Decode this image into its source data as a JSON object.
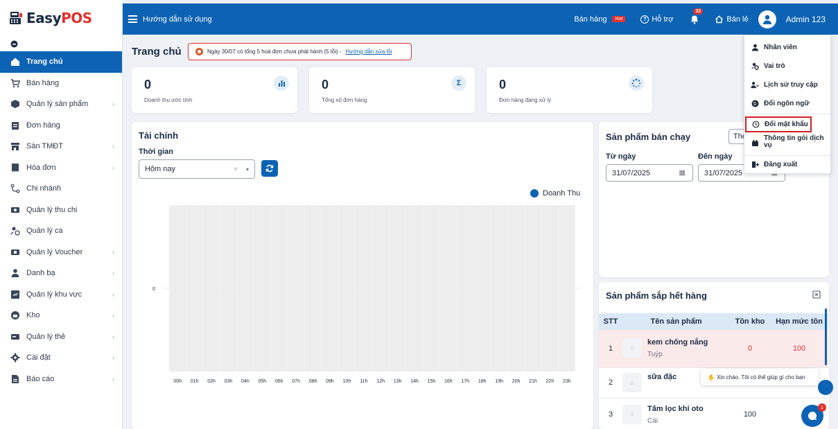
{
  "brand": {
    "name_a": "Easy",
    "name_b": "POS"
  },
  "sidebar": {
    "items": [
      {
        "label": "Trang chủ",
        "icon": "home-icon",
        "active": true,
        "chevron": false
      },
      {
        "label": "Bán hàng",
        "icon": "cart-icon",
        "active": false,
        "chevron": false
      },
      {
        "label": "Quản lý sản phẩm",
        "icon": "box-icon",
        "active": false,
        "chevron": true
      },
      {
        "label": "Đơn hàng",
        "icon": "clipboard-icon",
        "active": false,
        "chevron": false
      },
      {
        "label": "Sàn TMĐT",
        "icon": "store-icon",
        "active": false,
        "chevron": true
      },
      {
        "label": "Hóa đơn",
        "icon": "invoice-icon",
        "active": false,
        "chevron": true
      },
      {
        "label": "Chi nhánh",
        "icon": "branch-icon",
        "active": false,
        "chevron": false
      },
      {
        "label": "Quản lý thu chi",
        "icon": "money-icon",
        "active": false,
        "chevron": false
      },
      {
        "label": "Quản lý ca",
        "icon": "shift-icon",
        "active": false,
        "chevron": false
      },
      {
        "label": "Quản lý Voucher",
        "icon": "voucher-icon",
        "active": false,
        "chevron": true
      },
      {
        "label": "Danh bạ",
        "icon": "contact-icon",
        "active": false,
        "chevron": true
      },
      {
        "label": "Quản lý khu vực",
        "icon": "map-icon",
        "active": false,
        "chevron": true
      },
      {
        "label": "Kho",
        "icon": "warehouse-icon",
        "active": false,
        "chevron": true
      },
      {
        "label": "Quản lý thẻ",
        "icon": "card-icon",
        "active": false,
        "chevron": true
      },
      {
        "label": "Cài đặt",
        "icon": "gear-icon",
        "active": false,
        "chevron": true
      },
      {
        "label": "Báo cáo",
        "icon": "report-icon",
        "active": false,
        "chevron": true
      }
    ]
  },
  "topbar": {
    "title": "Hướng dẫn sử dụng",
    "sale": "Bán hàng",
    "hot": "Hot",
    "support": "Hỗ trợ",
    "notif_count": "32",
    "retail": "Bán lẻ",
    "user": "Admin 123"
  },
  "dropdown": {
    "items": [
      {
        "label": "Nhân viên",
        "icon": "user-icon"
      },
      {
        "label": "Vai trò",
        "icon": "role-icon"
      },
      {
        "label": "Lịch sử truy cập",
        "icon": "history-icon"
      },
      {
        "label": "Đổi ngôn ngữ",
        "icon": "globe-icon"
      },
      {
        "label": "Đổi mật khẩu",
        "icon": "key-icon"
      },
      {
        "label": "Thông tin gói dịch vụ",
        "icon": "package-icon"
      },
      {
        "label": "Đăng xuất",
        "icon": "logout-icon"
      }
    ]
  },
  "page": {
    "title": "Trang chủ",
    "alert_text": "Ngày 30/07 có tổng 5 hoá đơn chưa phát hành (5 lỗi) -",
    "alert_link": "Hướng dẫn sửa lỗi"
  },
  "stats": [
    {
      "value": "0",
      "label": "Doanh thu ước tính",
      "icon": "bar-chart-icon"
    },
    {
      "value": "0",
      "label": "Tổng số đơn hàng",
      "icon": "sigma-icon"
    },
    {
      "value": "0",
      "label": "Đơn hàng đang xử lý",
      "icon": "spinner-icon"
    }
  ],
  "finance": {
    "title": "Tài chính",
    "time_label": "Thời gian",
    "time_value": "Hôm nay",
    "clear": "×",
    "dropdown_arrow": "▾"
  },
  "chart_data": {
    "type": "bar",
    "categories": [
      "00h",
      "01h",
      "02h",
      "03h",
      "04h",
      "05h",
      "06h",
      "07h",
      "08h",
      "09h",
      "10h",
      "11h",
      "12h",
      "13h",
      "14h",
      "15h",
      "16h",
      "17h",
      "18h",
      "19h",
      "20h",
      "21h",
      "22h",
      "23h"
    ],
    "series": [
      {
        "name": "Doanh Thu",
        "values": [
          0,
          0,
          0,
          0,
          0,
          0,
          0,
          0,
          0,
          0,
          0,
          0,
          0,
          0,
          0,
          0,
          0,
          0,
          0,
          0,
          0,
          0,
          0,
          0
        ]
      }
    ],
    "ytick": "0",
    "bar_color": "#0d63b3",
    "background_bar_color": "#ededed",
    "legend": "top-right"
  },
  "best_sellers": {
    "title": "Sản phẩm bán chạy",
    "sort": "Theo doanh thu",
    "from_label": "Từ ngày",
    "from_value": "31/07/2025",
    "to_label": "Đến ngày",
    "to_value": "31/07/2025"
  },
  "low_stock": {
    "title": "Sản phẩm sắp hết hàng",
    "headers": [
      "STT",
      "Tên sản phẩm",
      "Tồn kho",
      "Hạn mức tồn"
    ],
    "rows": [
      {
        "stt": "1",
        "name": "kem chống nắng",
        "unit": "Tuýp",
        "stock": "0",
        "limit": "100"
      },
      {
        "stt": "2",
        "name": "sữa đặc",
        "unit": "",
        "stock": "",
        "limit": ""
      },
      {
        "stt": "3",
        "name": "Tấm lọc khí oto",
        "unit": "Cái",
        "stock": "100",
        "limit": ""
      }
    ]
  },
  "chat": {
    "greeting": "Xin chào. Tôi có thể giúp gì cho bạn",
    "badge": "1"
  }
}
